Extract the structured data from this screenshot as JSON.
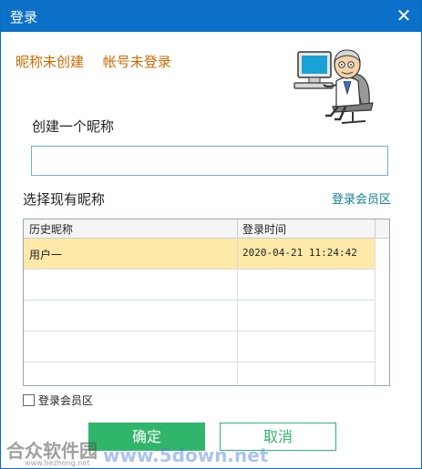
{
  "window": {
    "title": "登录",
    "close_glyph": "✕"
  },
  "status": {
    "nickname_status": "昵称未创建",
    "account_status": "帐号未登录"
  },
  "create": {
    "label": "创建一个昵称",
    "input_value": ""
  },
  "select": {
    "label": "选择现有昵称",
    "member_link": "登录会员区"
  },
  "table": {
    "headers": [
      "历史昵称",
      "登录时间"
    ],
    "rows": [
      {
        "name": "用户一",
        "time": "2020-04-21 11:24:42",
        "selected": true
      }
    ]
  },
  "options": {
    "member_checkbox_label": "登录会员区",
    "member_checkbox_checked": false
  },
  "buttons": {
    "ok": "确定",
    "cancel": "取消"
  },
  "watermark": {
    "brand_cn": "合众软件园",
    "brand_url": "www.5down.net",
    "small_url": "www.hezhong.net"
  },
  "colors": {
    "titlebar": "#0b70c8",
    "status_text": "#cc6a00",
    "link": "#0f7f9a",
    "accent": "#30b56b",
    "selected_row": "#fde9a8"
  }
}
